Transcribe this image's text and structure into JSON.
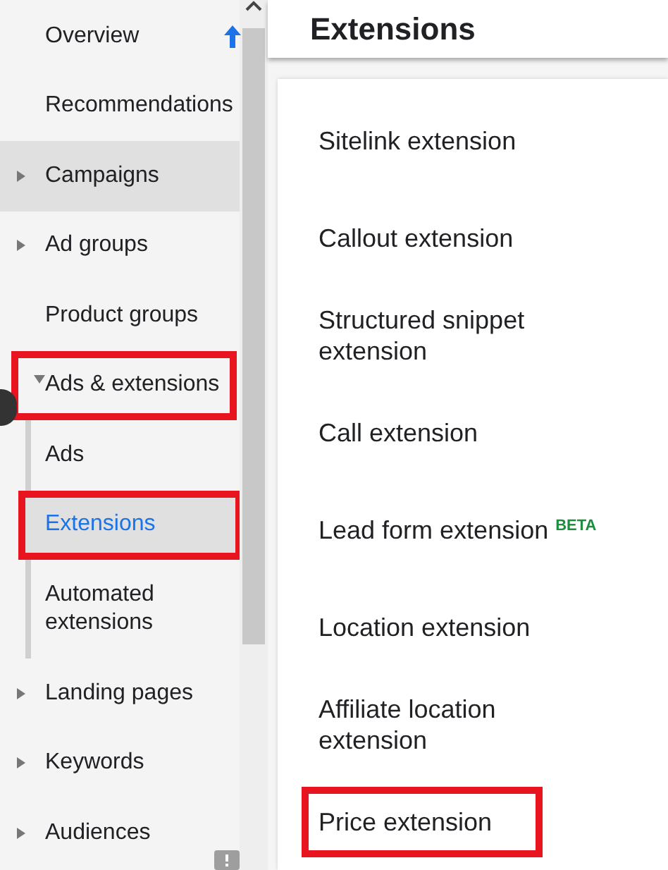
{
  "sidebar": {
    "items": [
      {
        "label": "Overview",
        "kind": "link",
        "hovered": false,
        "highlighted": false
      },
      {
        "label": "Recommendations",
        "kind": "link",
        "hovered": false,
        "highlighted": false
      },
      {
        "label": "Campaigns",
        "kind": "group",
        "expanded": false,
        "hovered": true,
        "highlighted": false
      },
      {
        "label": "Ad groups",
        "kind": "group",
        "expanded": false,
        "hovered": false,
        "highlighted": false
      },
      {
        "label": "Product groups",
        "kind": "link",
        "hovered": false,
        "highlighted": false
      },
      {
        "label": "Ads & extensions",
        "kind": "group",
        "expanded": true,
        "hovered": false,
        "highlighted": true,
        "children": [
          {
            "label": "Ads",
            "selected": false,
            "highlighted": false
          },
          {
            "label": "Extensions",
            "selected": true,
            "highlighted": true
          },
          {
            "label": "Automated extensions",
            "selected": false,
            "highlighted": false
          }
        ]
      },
      {
        "label": "Landing pages",
        "kind": "group",
        "expanded": false,
        "hovered": false,
        "highlighted": false
      },
      {
        "label": "Keywords",
        "kind": "group",
        "expanded": false,
        "hovered": false,
        "highlighted": false
      },
      {
        "label": "Audiences",
        "kind": "group",
        "expanded": false,
        "hovered": false,
        "highlighted": false
      }
    ]
  },
  "header": {
    "title": "Extensions"
  },
  "extension_menu": {
    "items": [
      {
        "label": "Sitelink extension",
        "highlighted": false
      },
      {
        "label": "Callout extension",
        "highlighted": false
      },
      {
        "label": "Structured snippet extension",
        "highlighted": false
      },
      {
        "label": "Call extension",
        "highlighted": false
      },
      {
        "label": "Lead form extension",
        "badge": "BETA",
        "highlighted": false
      },
      {
        "label": "Location extension",
        "highlighted": false
      },
      {
        "label": "Affiliate location extension",
        "highlighted": false
      },
      {
        "label": "Price extension",
        "highlighted": true
      }
    ]
  }
}
